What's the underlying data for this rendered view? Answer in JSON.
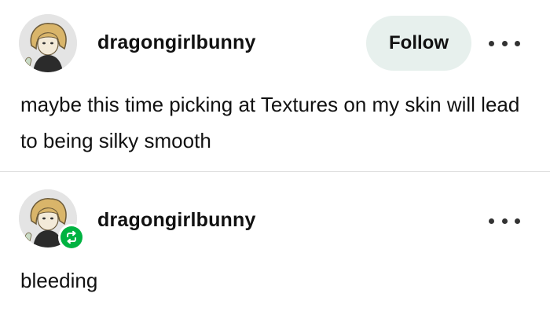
{
  "post": {
    "username": "dragongirlbunny",
    "follow_label": "Follow",
    "body": "maybe this time picking at Textures on my skin will lead to being silky smooth",
    "more_icon": "more-horizontal-icon"
  },
  "reblog": {
    "username": "dragongirlbunny",
    "body": "bleeding",
    "badge_icon": "reblog-icon",
    "badge_color": "#00b341",
    "more_icon": "more-horizontal-icon"
  },
  "colors": {
    "follow_bg": "#e7f0ed",
    "text": "#111111",
    "divider": "#dcdcdc"
  }
}
